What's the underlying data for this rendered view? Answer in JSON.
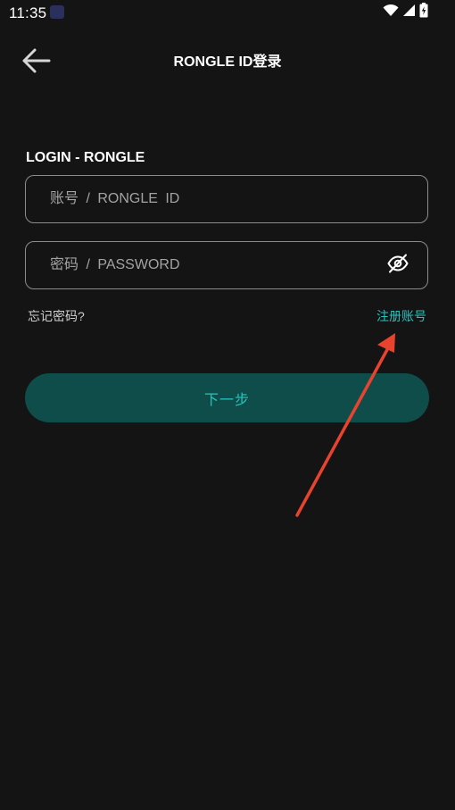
{
  "status_bar": {
    "time": "11:35",
    "icons": [
      "wifi-icon",
      "signal-icon",
      "battery-icon"
    ]
  },
  "app_bar": {
    "title": "RONGLE ID登录",
    "back_icon": "arrow-left-icon"
  },
  "form": {
    "section_label": "LOGIN - RONGLE",
    "username": {
      "value": "",
      "placeholder": "账号 / RONGLE ID"
    },
    "password": {
      "value": "",
      "placeholder": "密码 / PASSWORD",
      "toggle_icon": "eye-off-icon"
    },
    "forgot_password_label": "忘记密码?",
    "register_label": "注册账号",
    "next_label": "下一步"
  },
  "colors": {
    "background": "#141414",
    "accent": "#27c3bd",
    "button_bg": "#0e4d49",
    "annotation": "#e8432e"
  }
}
